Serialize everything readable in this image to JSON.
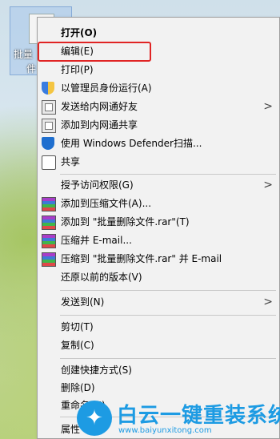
{
  "desktop": {
    "icon_label_1": "批量",
    "icon_label_2": "件"
  },
  "menu": {
    "items": [
      {
        "label": "打开(O)"
      },
      {
        "label": "编辑(E)"
      },
      {
        "label": "打印(P)"
      },
      {
        "label": "以管理员身份运行(A)"
      },
      {
        "label": "发送给内网通好友"
      },
      {
        "label": "添加到内网通共享"
      },
      {
        "label": "使用 Windows Defender扫描..."
      },
      {
        "label": "共享"
      },
      {
        "label": "授予访问权限(G)"
      },
      {
        "label": "添加到压缩文件(A)..."
      },
      {
        "label": "添加到 \"批量删除文件.rar\"(T)"
      },
      {
        "label": "压缩并 E-mail..."
      },
      {
        "label": "压缩到 \"批量删除文件.rar\" 并 E-mail"
      },
      {
        "label": "还原以前的版本(V)"
      },
      {
        "label": "发送到(N)"
      },
      {
        "label": "剪切(T)"
      },
      {
        "label": "复制(C)"
      },
      {
        "label": "创建快捷方式(S)"
      },
      {
        "label": "删除(D)"
      },
      {
        "label": "重命名(M)"
      },
      {
        "label": "属性"
      }
    ],
    "submenu_arrow": ">",
    "highlight_color": "#e02424"
  },
  "watermark": {
    "title": "白云一键重装系统",
    "url": "www.baiyunxitong.com",
    "color": "#1d9be3"
  }
}
